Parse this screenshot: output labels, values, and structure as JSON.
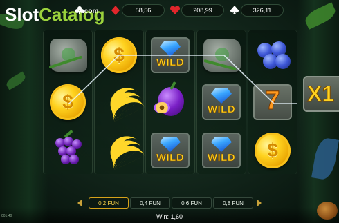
{
  "brand": {
    "part1": "Slot",
    "part2": "Catalog",
    "tld": ".com"
  },
  "hud": [
    {
      "icon": "club-icon",
      "value": ""
    },
    {
      "icon": "diamond-icon",
      "value": "58,56"
    },
    {
      "icon": "heart-icon",
      "value": "208,99"
    },
    {
      "icon": "spade-icon",
      "value": "326,11"
    }
  ],
  "reels": [
    [
      "stone-paw",
      "gold-coin",
      "grapes"
    ],
    [
      "gold-coin",
      "bananas",
      "bananas"
    ],
    [
      "wild",
      "plum",
      "wild"
    ],
    [
      "stone-paw",
      "wild",
      "wild"
    ],
    [
      "blueberries",
      "seven",
      "gold-coin"
    ]
  ],
  "wild_label": "WILD",
  "seven_label": "7",
  "coin_label": "$",
  "multiplier": "X1",
  "bets": [
    "0,2 FUN",
    "0,4 FUN",
    "0,6 FUN",
    "0,8 FUN"
  ],
  "active_bet": 0,
  "win_text": "Win: 1,60",
  "small_corner_text": "001,40",
  "colors": {
    "accent_gold": "#ffd21f",
    "brand_green": "#9bd23c",
    "payline": "#ffffff"
  }
}
